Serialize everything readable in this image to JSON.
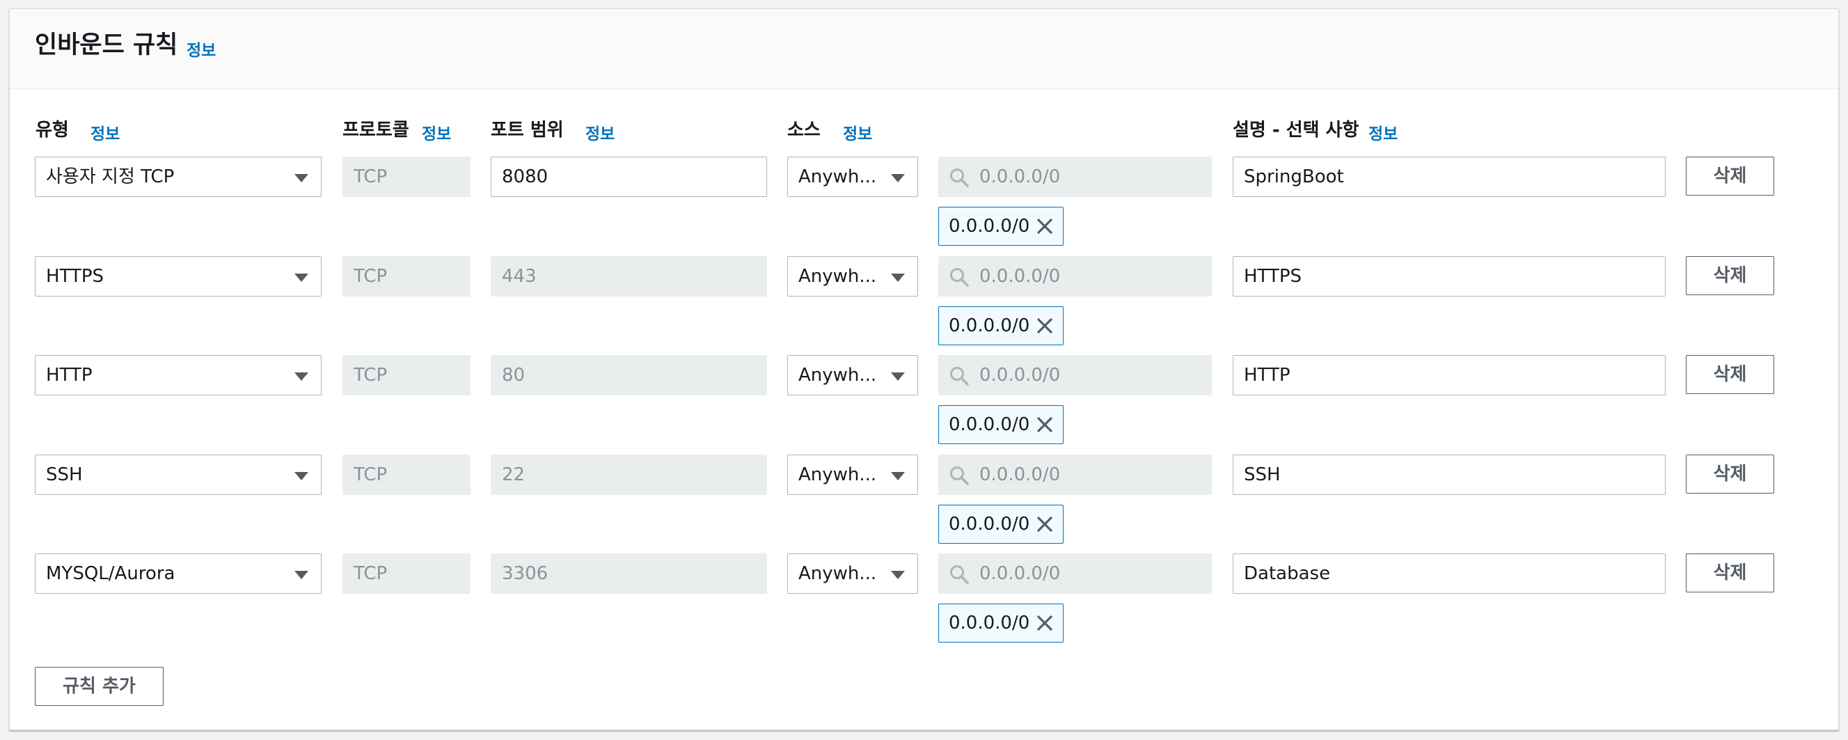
{
  "section": {
    "title": "인바운드 규칙",
    "info_label": "정보"
  },
  "columns": {
    "type": "유형",
    "protocol": "프로토콜",
    "port_range": "포트 범위",
    "source": "소스",
    "description": "설명 - 선택 사항",
    "info_label": "정보"
  },
  "rules": [
    {
      "type": "사용자 지정 TCP",
      "protocol": "TCP",
      "port": "8080",
      "source": "Anywh...",
      "cidr_placeholder": "0.0.0.0/0",
      "token": "0.0.0.0/0",
      "description": "SpringBoot",
      "delete_label": "삭제"
    },
    {
      "type": "HTTPS",
      "protocol": "TCP",
      "port": "443",
      "source": "Anywh...",
      "cidr_placeholder": "0.0.0.0/0",
      "token": "0.0.0.0/0",
      "description": "HTTPS",
      "delete_label": "삭제"
    },
    {
      "type": "HTTP",
      "protocol": "TCP",
      "port": "80",
      "source": "Anywh...",
      "cidr_placeholder": "0.0.0.0/0",
      "token": "0.0.0.0/0",
      "description": "HTTP",
      "delete_label": "삭제"
    },
    {
      "type": "SSH",
      "protocol": "TCP",
      "port": "22",
      "source": "Anywh...",
      "cidr_placeholder": "0.0.0.0/0",
      "token": "0.0.0.0/0",
      "description": "SSH",
      "delete_label": "삭제"
    },
    {
      "type": "MYSQL/Aurora",
      "protocol": "TCP",
      "port": "3306",
      "source": "Anywh...",
      "cidr_placeholder": "0.0.0.0/0",
      "token": "0.0.0.0/0",
      "description": "Database",
      "delete_label": "삭제"
    }
  ],
  "add_rule_label": "규칙 추가",
  "icons": {
    "search": "search-icon",
    "dropdown": "caret-down-icon",
    "remove": "close-icon"
  }
}
